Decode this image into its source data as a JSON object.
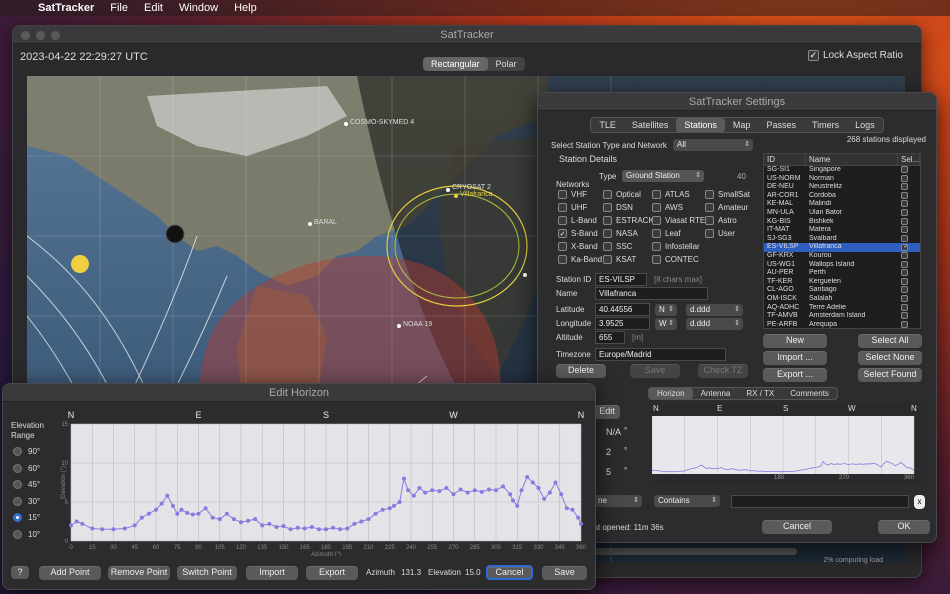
{
  "menubar": {
    "app": "SatTracker",
    "items": [
      "File",
      "Edit",
      "Window",
      "Help"
    ]
  },
  "main": {
    "title": "SatTracker",
    "datetime": "2023-04-22  22:29:27 UTC",
    "lock_label": "Lock Aspect Ratio",
    "seg": [
      "Rectangular",
      "Polar"
    ],
    "sat_labels": [
      "COSMO-SKYMED 4",
      "CRYOSAT 2",
      "Villafranca",
      "BARAL",
      "NOAA 19"
    ],
    "status": "2% computing load"
  },
  "settings": {
    "title": "SatTracker Settings",
    "tabs": [
      "TLE",
      "Satellites",
      "Stations",
      "Map",
      "Passes",
      "Timers",
      "Logs"
    ],
    "stations_count": "268 stations displayed",
    "select_label": "Select Station Type and Network",
    "select_value": "All",
    "station_details": "Station Details",
    "type_label": "Type",
    "type_value": "Ground Station",
    "type_count": "40",
    "networks_label": "Networks",
    "networks": [
      [
        "VHF",
        "Optical",
        "ATLAS",
        "SmallSat"
      ],
      [
        "UHF",
        "DSN",
        "AWS",
        "Amateur"
      ],
      [
        "L-Band",
        "ESTRACK",
        "Viasat RTE",
        "Astro"
      ],
      [
        "S-Band",
        "NASA",
        "Leaf",
        "User"
      ],
      [
        "X-Band",
        "SSC",
        "Infostellar",
        ""
      ],
      [
        "Ka-Band",
        "KSAT",
        "CONTEC",
        ""
      ]
    ],
    "station_id_label": "Station ID",
    "station_id": "ES-VILSP",
    "station_id_hint": "[8 chars max]",
    "name_label": "Name",
    "name": "Villafranca",
    "lat_label": "Latitude",
    "lat": "40.44556",
    "lat_dir": "N",
    "lat_fmt": "d.ddd",
    "lon_label": "Longitude",
    "lon": "3.9525",
    "lon_dir": "W",
    "lon_fmt": "d.ddd",
    "alt_label": "Altitude",
    "alt": "655",
    "alt_unit": "[m]",
    "tz_label": "Timezone",
    "tz": "Europe/Madrid",
    "delete": "Delete",
    "save": "Save",
    "check_tz": "Check TZ",
    "table_headers": [
      "ID",
      "Name",
      "Sel..."
    ],
    "stations": [
      [
        "SG-SI1",
        "Singapore"
      ],
      [
        "US-NORM",
        "Norman"
      ],
      [
        "DE-NEU",
        "Neustrelitz"
      ],
      [
        "AR-COR1",
        "Córdoba"
      ],
      [
        "KE-MAL",
        "Malindi"
      ],
      [
        "MN-ULA",
        "Ulan Bator"
      ],
      [
        "KG-BIS",
        "Bishkek"
      ],
      [
        "IT-MAT",
        "Matera"
      ],
      [
        "SJ-SG3",
        "Svalbard"
      ],
      [
        "ES-VILSP",
        "Villafranca"
      ],
      [
        "GF-KRX",
        "Kourou"
      ],
      [
        "US-WG1",
        "Wallops Island"
      ],
      [
        "AU-PER",
        "Perth"
      ],
      [
        "TF-KER",
        "Kerguelen"
      ],
      [
        "CL-AGO",
        "Santiago"
      ],
      [
        "OM-ISCK",
        "Salalah"
      ],
      [
        "AQ-ADHC",
        "Terre Adelie"
      ],
      [
        "TF-AMVB",
        "Amsterdam Island"
      ],
      [
        "PE-ARFB",
        "Arequipa"
      ]
    ],
    "btn_new": "New",
    "btn_import": "Import ...",
    "btn_export": "Export ...",
    "btn_select_all": "Select All",
    "btn_select_none": "Select None",
    "btn_select_found": "Select Found",
    "sub_tabs": [
      "Horizon",
      "Antenna",
      "RX / TX",
      "Comments"
    ],
    "edit_btn": "Edit",
    "na": "N/A",
    "val2": "2",
    "val5": "5",
    "deg": "°",
    "filter_op": "Contains",
    "filter_field": "ne",
    "filter_clear": "x",
    "last_opened": "st opened:  11m 36s",
    "cancel": "Cancel",
    "ok": "OK",
    "mini_dirs": [
      "N",
      "E",
      "S",
      "W",
      "N"
    ],
    "mini_ticks": [
      "180",
      "270",
      "360"
    ]
  },
  "horizon": {
    "title": "Edit Horizon",
    "range_label": "Elevation\nRange",
    "ranges": [
      "90°",
      "60°",
      "45°",
      "30°",
      "15°",
      "10°"
    ],
    "selected_range": "15°",
    "dirs": [
      "N",
      "E",
      "S",
      "W",
      "N"
    ],
    "xlabel": "Azimuth (°)",
    "ylabel": "Elevation (°)",
    "x_ticks": [
      "0",
      "15",
      "30",
      "45",
      "60",
      "75",
      "90",
      "105",
      "120",
      "135",
      "150",
      "165",
      "180",
      "195",
      "210",
      "225",
      "240",
      "255",
      "270",
      "285",
      "300",
      "315",
      "330",
      "345",
      "360"
    ],
    "y_ticks": [
      "15",
      "10",
      "5",
      "0"
    ],
    "help": "?",
    "add_point": "Add Point",
    "remove_point": "Remove Point",
    "switch_point": "Switch Point",
    "import": "Import",
    "export": "Export",
    "azimuth_label": "Azimuth",
    "azimuth_value": "131.3",
    "elevation_label": "Elevation",
    "elevation_value": "15.0",
    "cancel": "Cancel",
    "save": "Save"
  },
  "chart_data": {
    "type": "scatter",
    "title": "",
    "xlabel": "Azimuth (°)",
    "ylabel": "Elevation (°)",
    "xlim": [
      0,
      360
    ],
    "ylim": [
      0,
      15
    ],
    "x": [
      0,
      4,
      8,
      15,
      22,
      30,
      38,
      45,
      50,
      55,
      60,
      64,
      68,
      72,
      75,
      78,
      82,
      86,
      90,
      95,
      100,
      105,
      110,
      115,
      120,
      125,
      130,
      135,
      140,
      145,
      150,
      155,
      160,
      165,
      170,
      175,
      180,
      185,
      190,
      195,
      200,
      205,
      210,
      215,
      220,
      225,
      228,
      232,
      235,
      238,
      242,
      246,
      250,
      255,
      260,
      265,
      270,
      275,
      280,
      285,
      290,
      295,
      300,
      305,
      310,
      312,
      315,
      318,
      322,
      326,
      330,
      334,
      338,
      342,
      346,
      350,
      354,
      358,
      360
    ],
    "y": [
      2,
      2.5,
      2.2,
      1.6,
      1.5,
      1.5,
      1.6,
      2.0,
      3.0,
      3.5,
      4.0,
      4.8,
      5.8,
      4.5,
      3.5,
      4.0,
      3.6,
      3.4,
      3.5,
      4.2,
      3.0,
      2.8,
      3.5,
      2.8,
      2.4,
      2.6,
      2.8,
      2.0,
      2.2,
      1.8,
      1.9,
      1.5,
      1.7,
      1.6,
      1.8,
      1.5,
      1.5,
      1.7,
      1.5,
      1.6,
      2.2,
      2.5,
      2.8,
      3.5,
      4.0,
      4.2,
      4.5,
      5.0,
      8.0,
      6.5,
      5.8,
      6.8,
      6.2,
      6.5,
      6.4,
      6.8,
      6.0,
      6.6,
      6.2,
      6.5,
      6.3,
      6.6,
      6.5,
      7.0,
      6.0,
      5.2,
      4.5,
      6.5,
      8.2,
      7.5,
      6.8,
      5.4,
      6.2,
      7.5,
      6.0,
      4.2,
      4.0,
      3.0,
      2.2
    ]
  }
}
